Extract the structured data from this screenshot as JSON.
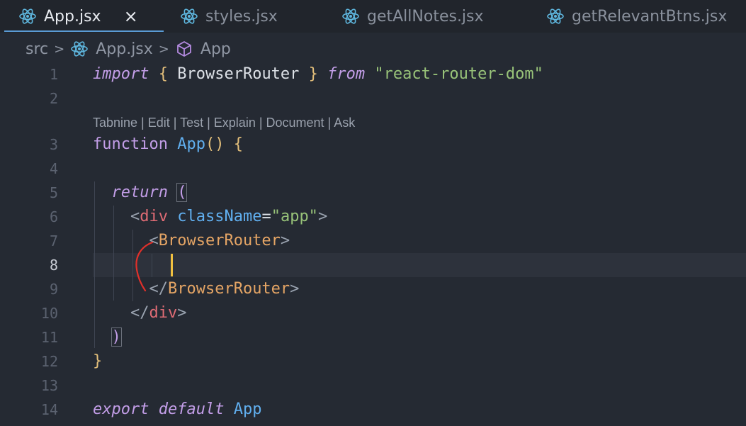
{
  "tabs": [
    {
      "label": "App.jsx",
      "active": true,
      "close": "×",
      "icon": "react-icon"
    },
    {
      "label": "styles.jsx",
      "active": false,
      "icon": "react-icon"
    },
    {
      "label": "getAllNotes.jsx",
      "active": false,
      "icon": "react-icon"
    },
    {
      "label": "getRelevantBtns.jsx",
      "active": false,
      "icon": "react-icon"
    }
  ],
  "breadcrumb": {
    "folder": "src",
    "file": "App.jsx",
    "symbol": "App",
    "separator": ">"
  },
  "codelens": "Tabnine | Edit | Test | Explain | Document | Ask",
  "line_numbers": [
    "1",
    "2",
    "3",
    "4",
    "5",
    "6",
    "7",
    "8",
    "9",
    "10",
    "11",
    "12",
    "13",
    "14"
  ],
  "code": {
    "l1": {
      "import": "import",
      "open": "{",
      "name": "BrowserRouter",
      "close": "}",
      "from": "from",
      "module": "\"react-router-dom\""
    },
    "l3": {
      "kw": "function",
      "name": "App",
      "parens": "()",
      "brace": "{"
    },
    "l5": {
      "kw": "return",
      "paren": "("
    },
    "l6": {
      "lt": "<",
      "tag": "div",
      "attr": "className",
      "eq": "=",
      "val": "\"app\"",
      "gt": ">"
    },
    "l7": {
      "lt": "<",
      "tag": "BrowserRouter",
      "gt": ">"
    },
    "l9": {
      "lt": "</",
      "tag": "BrowserRouter",
      "gt": ">"
    },
    "l10": {
      "lt": "</",
      "tag": "div",
      "gt": ">"
    },
    "l11": {
      "paren": ")"
    },
    "l12": {
      "brace": "}"
    },
    "l14": {
      "kw1": "export",
      "kw2": "default",
      "name": "App"
    }
  },
  "colors": {
    "accent": "#5a9bd5",
    "cursor": "#f0c040",
    "annotation": "#e0302a"
  }
}
